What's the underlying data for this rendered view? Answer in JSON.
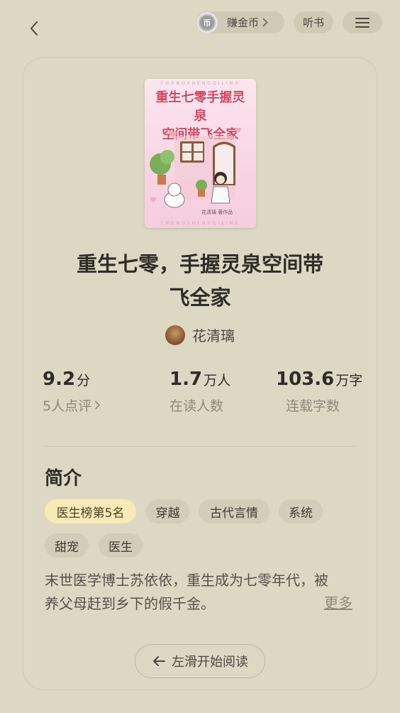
{
  "header": {
    "earn_coins_label": "赚金币",
    "coin_icon_glyph": "币",
    "listen_label": "听书"
  },
  "book": {
    "cover": {
      "title_line1": "重生七零手握灵泉",
      "title_line2": "空间带飞全家",
      "deco_text": "CHONGSHENGQILING",
      "author_text": "花清璃 著作品"
    },
    "title_line1": "重生七零，手握灵泉空间带",
    "title_line2": "飞全家",
    "author": "花清璃"
  },
  "stats": {
    "rating_value": "9.2",
    "rating_unit": "分",
    "rating_label": "5人点评",
    "readers_value": "1.7",
    "readers_unit": "万人",
    "readers_label": "在读人数",
    "words_value": "103.6",
    "words_unit": "万字",
    "words_label": "连载字数"
  },
  "intro": {
    "section_title": "简介",
    "tags": [
      "医生榜第5名",
      "穿越",
      "古代言情",
      "系统",
      "甜宠",
      "医生"
    ],
    "summary_line1": "末世医学博士苏依依，重生成为七零年代，被",
    "summary_line2": "养父母赶到乡下的假千金。",
    "more_label": "更多"
  },
  "start_reading_label": "左滑开始阅读",
  "colors": {
    "background": "#dcd8c3",
    "pill": "#cfcab3",
    "tag": "#d2cdb8",
    "highlight_tag": "#f8eab6",
    "cover_title": "#d9405f"
  },
  "icons": [
    "back-arrow-icon",
    "coin-icon",
    "chevron-right-icon",
    "menu-icon",
    "left-arrow-icon"
  ]
}
